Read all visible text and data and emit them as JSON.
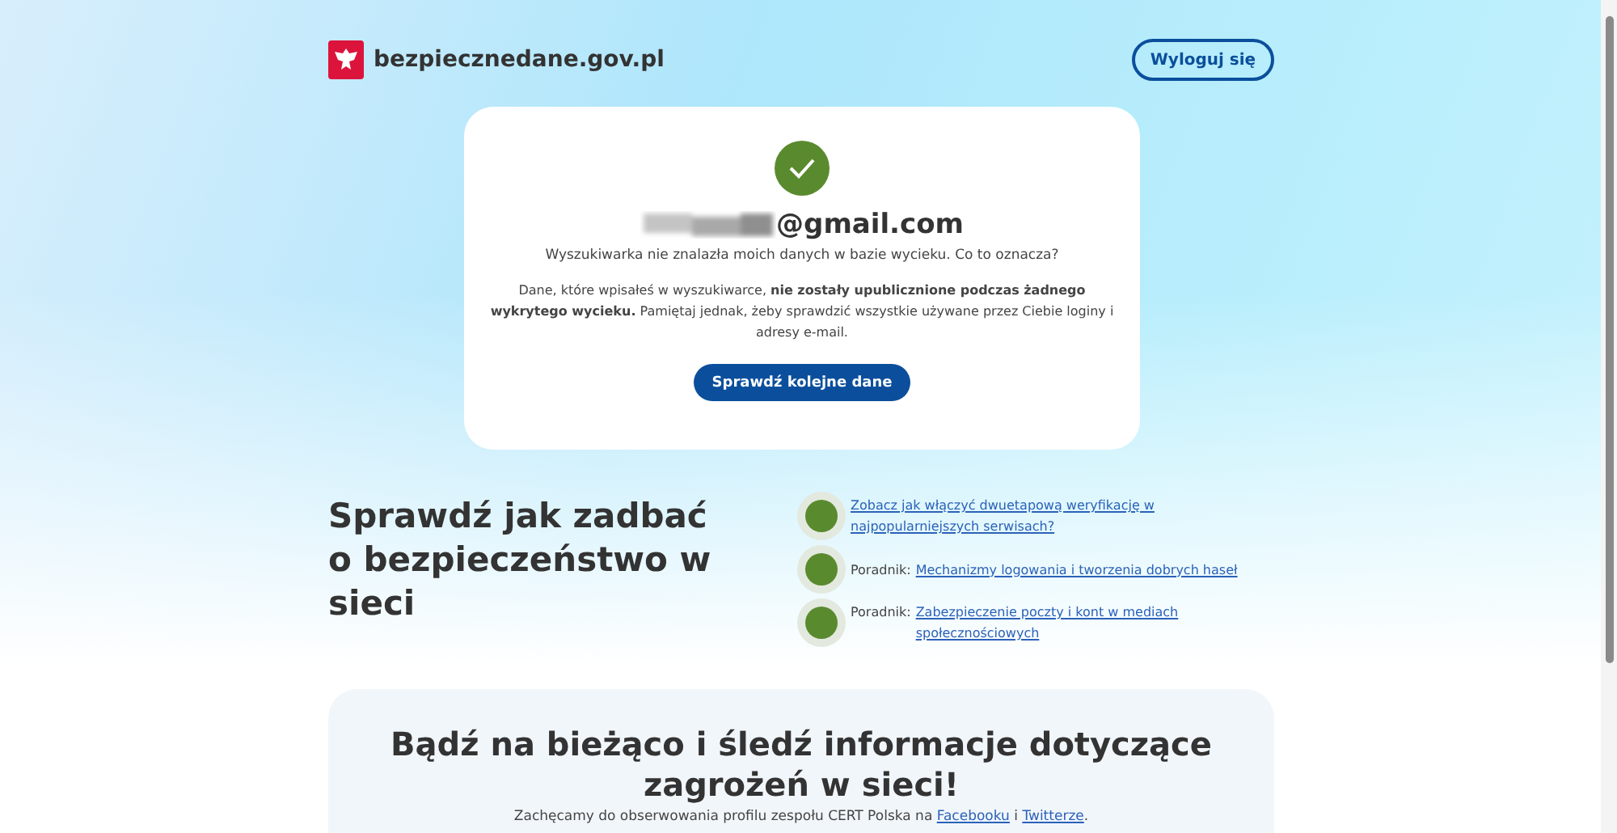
{
  "header": {
    "site_name": "bezpiecznedane.gov.pl",
    "logout_button": "Wyloguj się"
  },
  "result_card": {
    "email_domain": "@gmail.com",
    "email_redacted": true,
    "summary": "Wyszukiwarka nie znalazła moich danych w bazie wycieku. Co to oznacza?",
    "explanation": "Dane, które wpisałeś w wyszukiwarce, **nie zostały upublicznione podczas żadnego wykrytego wycieku.** Pamiętaj jednak, żeby sprawdzić wszystkie używane przez Ciebie loginy i adresy e-mail.",
    "button": "Sprawdź kolejne dane"
  },
  "tips": {
    "heading_lines": [
      "Sprawdź jak zadbać",
      "o bezpieczeństwo w sieci"
    ],
    "items": [
      {
        "link": "Zobacz jak włączyć dwuetapową weryfikację w najpopularniejszych serwisach?"
      },
      {
        "prefix": "Poradnik:",
        "link": "Mechanizmy logowania i tworzenia dobrych haseł"
      },
      {
        "prefix": "Poradnik:",
        "link": "Zabezpieczenie poczty i kont w mediach społecznościowych"
      }
    ]
  },
  "follow": {
    "heading": "Bądź na bieżąco i śledź informacje dotyczące zagrożeń w sieci!",
    "text_before": "Zachęcamy do obserwowania profilu zespołu CERT Polska na",
    "link_1": "Facebooku",
    "text_between": "i",
    "link_2": "Twitterze",
    "text_after": "."
  }
}
